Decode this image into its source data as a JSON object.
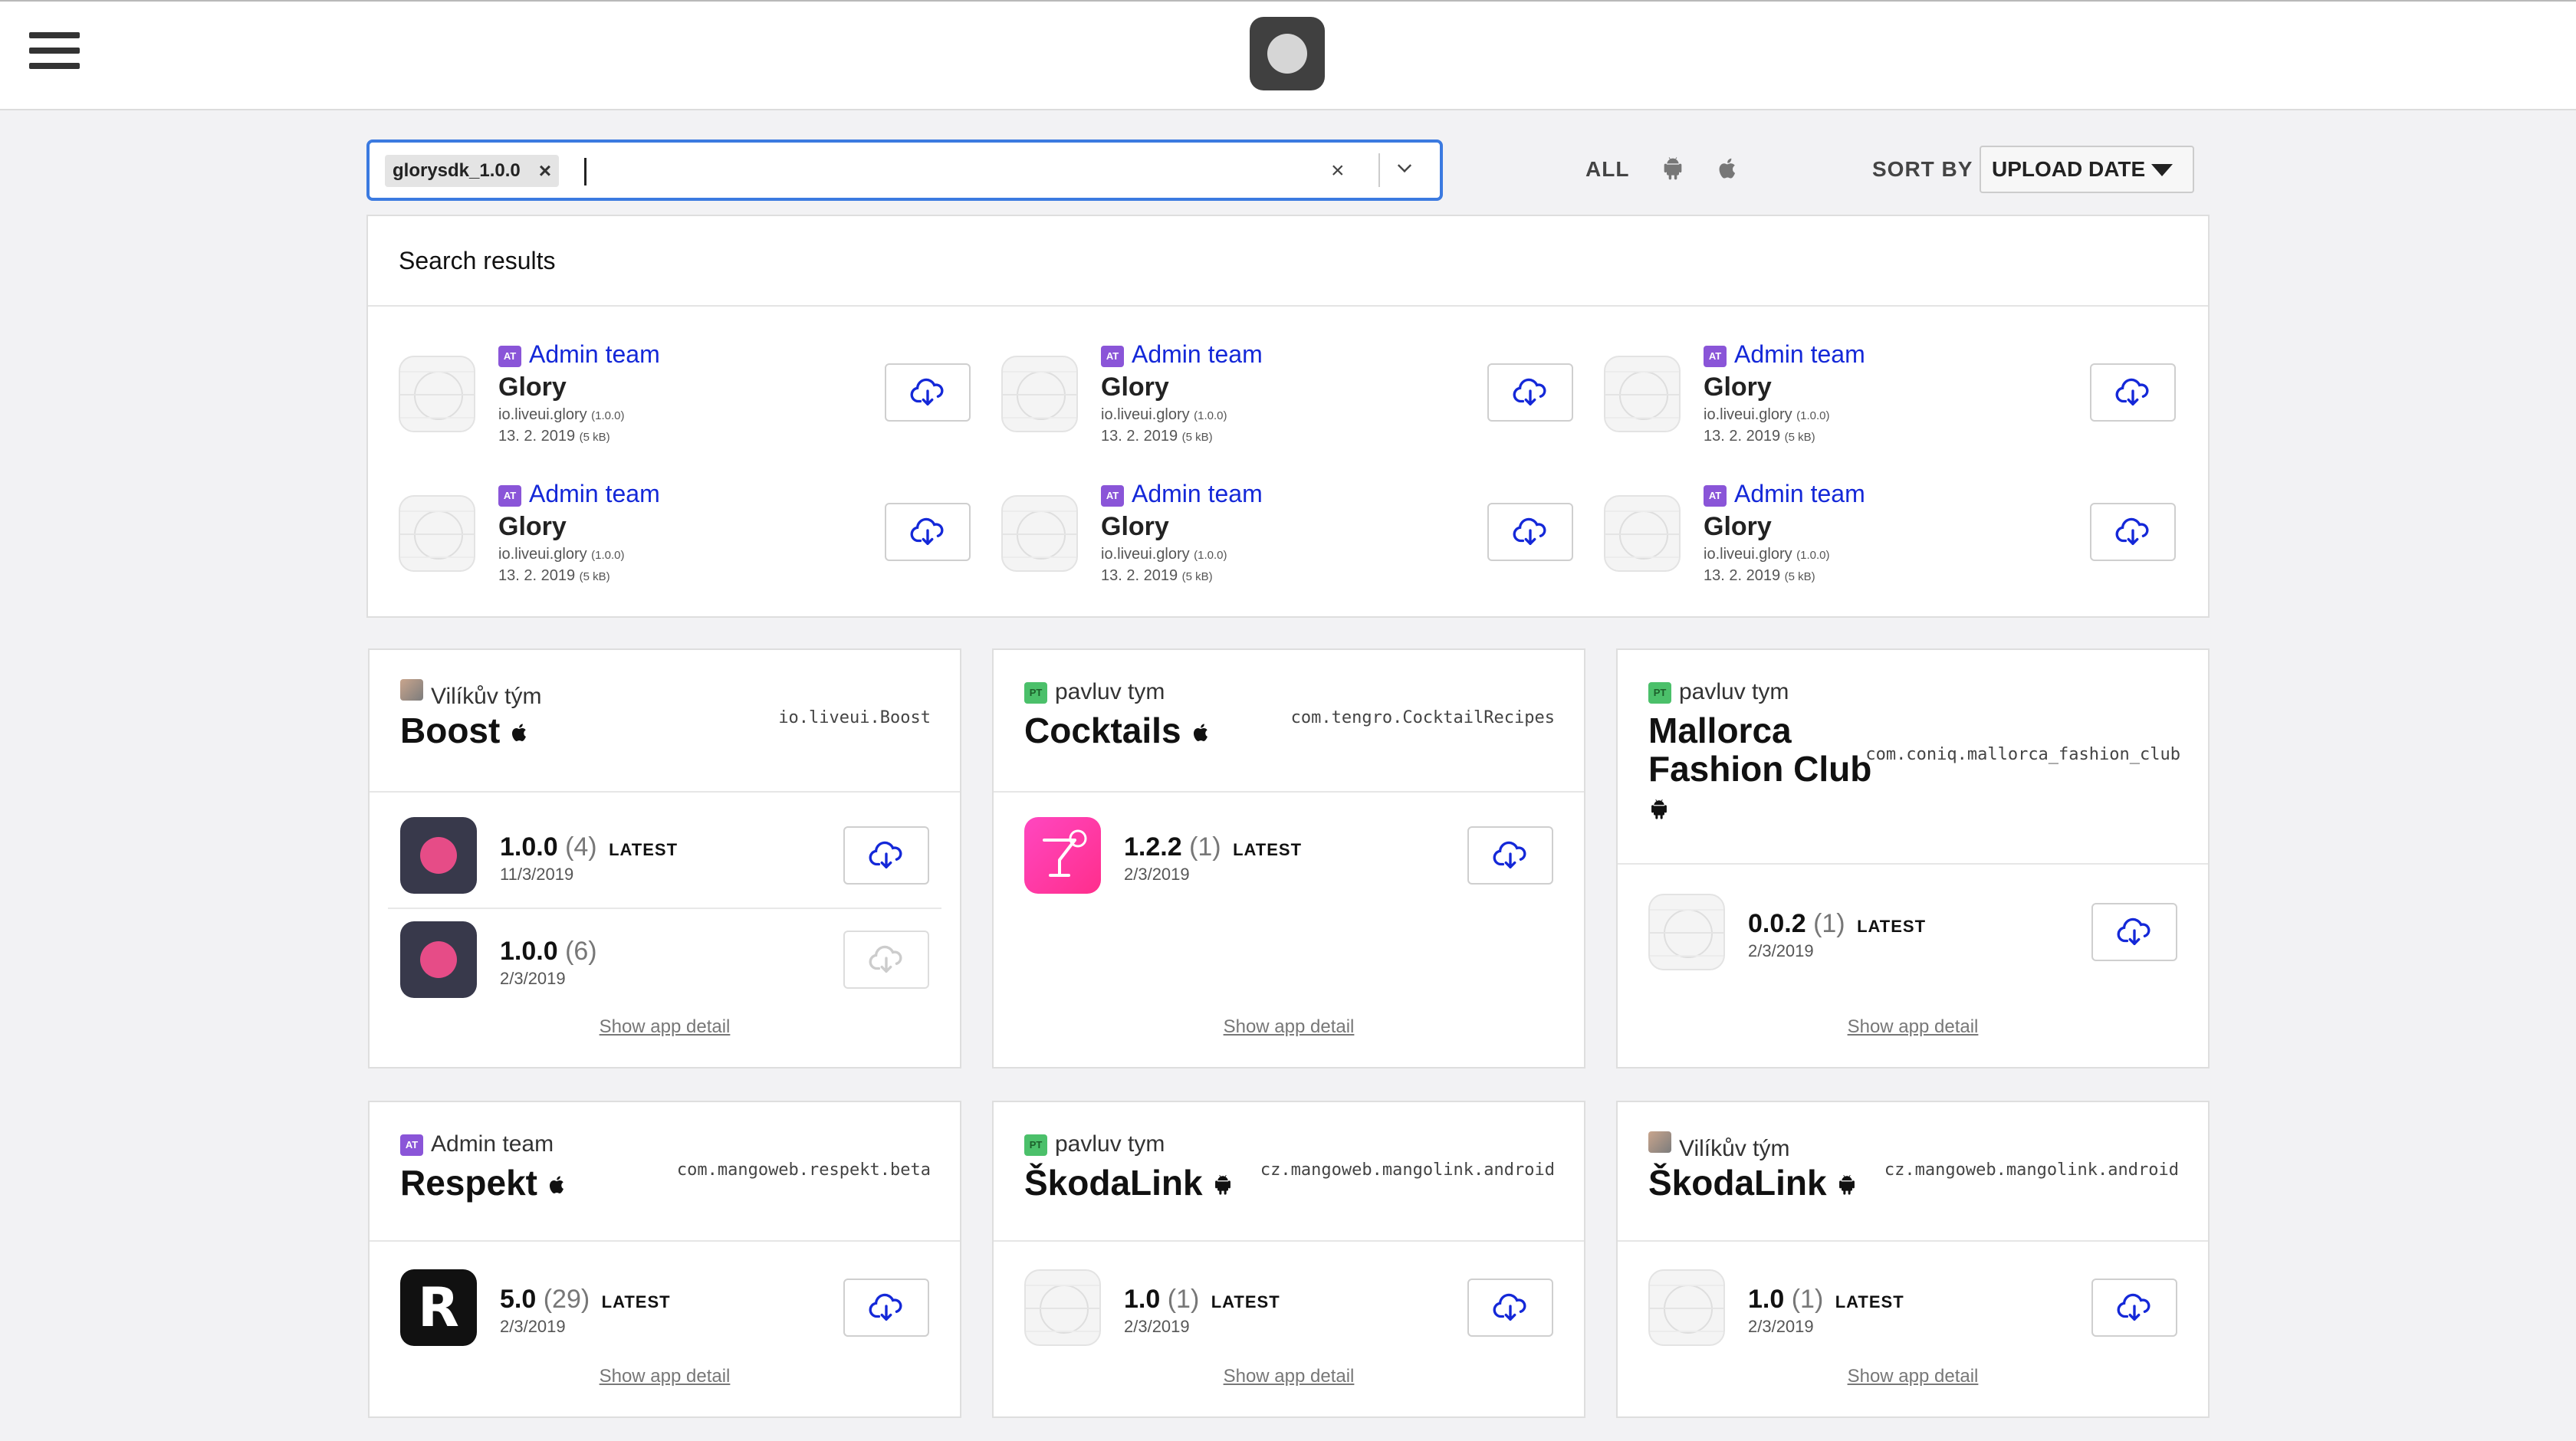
{
  "search": {
    "chip_label": "glorysdk_1.0.0",
    "chip_remove": "×",
    "clear": "×",
    "placeholder": ""
  },
  "filters": {
    "all_label": "ALL",
    "sort_by_label": "SORT BY",
    "sort_value": "UPLOAD DATE"
  },
  "results": {
    "heading": "Search results",
    "items": [
      {
        "team": "Admin team",
        "badge": "AT",
        "name": "Glory",
        "bundle": "io.liveui.glory",
        "version": "(1.0.0)",
        "date": "13. 2. 2019",
        "size": "(5 kB)"
      },
      {
        "team": "Admin team",
        "badge": "AT",
        "name": "Glory",
        "bundle": "io.liveui.glory",
        "version": "(1.0.0)",
        "date": "13. 2. 2019",
        "size": "(5 kB)"
      },
      {
        "team": "Admin team",
        "badge": "AT",
        "name": "Glory",
        "bundle": "io.liveui.glory",
        "version": "(1.0.0)",
        "date": "13. 2. 2019",
        "size": "(5 kB)"
      },
      {
        "team": "Admin team",
        "badge": "AT",
        "name": "Glory",
        "bundle": "io.liveui.glory",
        "version": "(1.0.0)",
        "date": "13. 2. 2019",
        "size": "(5 kB)"
      },
      {
        "team": "Admin team",
        "badge": "AT",
        "name": "Glory",
        "bundle": "io.liveui.glory",
        "version": "(1.0.0)",
        "date": "13. 2. 2019",
        "size": "(5 kB)"
      },
      {
        "team": "Admin team",
        "badge": "AT",
        "name": "Glory",
        "bundle": "io.liveui.glory",
        "version": "(1.0.0)",
        "date": "13. 2. 2019",
        "size": "(5 kB)"
      }
    ]
  },
  "cards": {
    "show_detail": "Show app detail",
    "latest": "LATEST",
    "boost": {
      "team": "Vilíkův tým",
      "title": "Boost",
      "bundle": "io.liveui.Boost",
      "v1": {
        "version": "1.0.0",
        "build": "(4)",
        "date": "11/3/2019"
      },
      "v2": {
        "version": "1.0.0",
        "build": "(6)",
        "date": "2/3/2019"
      }
    },
    "cocktails": {
      "team": "pavluv tym",
      "badge": "PT",
      "title": "Cocktails",
      "bundle": "com.tengro.CocktailRecipes",
      "v1": {
        "version": "1.2.2",
        "build": "(1)",
        "date": "2/3/2019"
      }
    },
    "mallorca": {
      "team": "pavluv tym",
      "badge": "PT",
      "title_line1": "Mallorca",
      "title_line2": "Fashion Club",
      "bundle": "com.coniq.mallorca_fashion_club",
      "v1": {
        "version": "0.0.2",
        "build": "(1)",
        "date": "2/3/2019"
      }
    },
    "respekt": {
      "team": "Admin team",
      "badge": "AT",
      "title": "Respekt",
      "bundle": "com.mangoweb.respekt.beta",
      "icon_letter": "R",
      "v1": {
        "version": "5.0",
        "build": "(29)",
        "date": "2/3/2019"
      }
    },
    "skodalink1": {
      "team": "pavluv tym",
      "badge": "PT",
      "title": "ŠkodaLink",
      "bundle": "cz.mangoweb.mangolink.android",
      "v1": {
        "version": "1.0",
        "build": "(1)",
        "date": "2/3/2019"
      }
    },
    "skodalink2": {
      "team": "Vilíkův tým",
      "title": "ŠkodaLink",
      "bundle": "cz.mangoweb.mangolink.android",
      "v1": {
        "version": "1.0",
        "build": "(1)",
        "date": "2/3/2019"
      }
    }
  },
  "colors": {
    "accent_blue": "#1428d8",
    "search_border": "#3b7ae0",
    "admin_badge": "#8a55d8",
    "pt_badge": "#4bc06a"
  },
  "icons": [
    "hamburger-icon",
    "app-logo",
    "android-icon",
    "apple-icon",
    "cloud-download-icon",
    "chevron-down-icon"
  ]
}
